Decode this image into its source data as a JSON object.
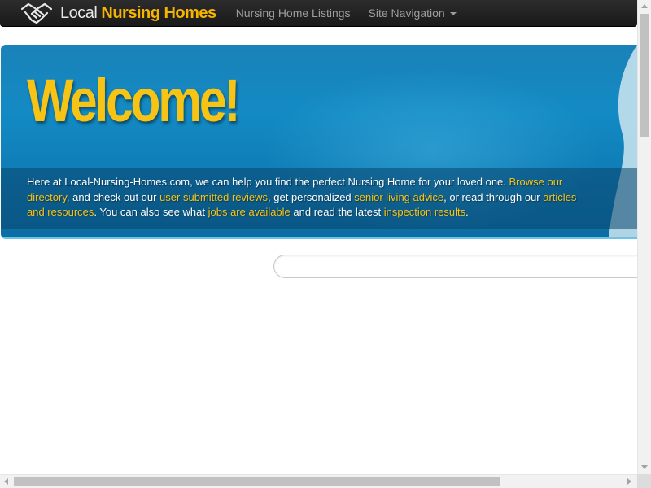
{
  "navbar": {
    "logo": {
      "icon": "handshake-icon",
      "text_local": "Local",
      "text_brand": "Nursing Homes"
    },
    "links": [
      {
        "label": "Nursing Home Listings"
      },
      {
        "label": "Site Navigation",
        "icon": "caret-down-icon"
      }
    ]
  },
  "hero": {
    "heading": "Welcome!",
    "intro": {
      "t1": "Here at Local-Nursing-Homes.com, we can help you find the perfect Nursing Home for your loved one. ",
      "link1": "Browse our directory",
      "t2": ", and check out our ",
      "link2": "user submitted reviews",
      "t3": ", get personalized ",
      "link3": "senior living advice",
      "t4": ", or read through our ",
      "link4": "articles and resources",
      "t5": ". You can also see what ",
      "link5": "jobs are available",
      "t6": " and read the latest ",
      "link6": "inspection results",
      "t7": "."
    }
  },
  "search": {
    "value": "",
    "placeholder": ""
  },
  "colors": {
    "navbar_bg": "#222222",
    "nav_link": "#9d9d9d",
    "brand_accent": "#f5b400",
    "hero_blue": "#138ac4",
    "heading_yellow": "#f7c415",
    "link_yellow": "#f7c415"
  }
}
